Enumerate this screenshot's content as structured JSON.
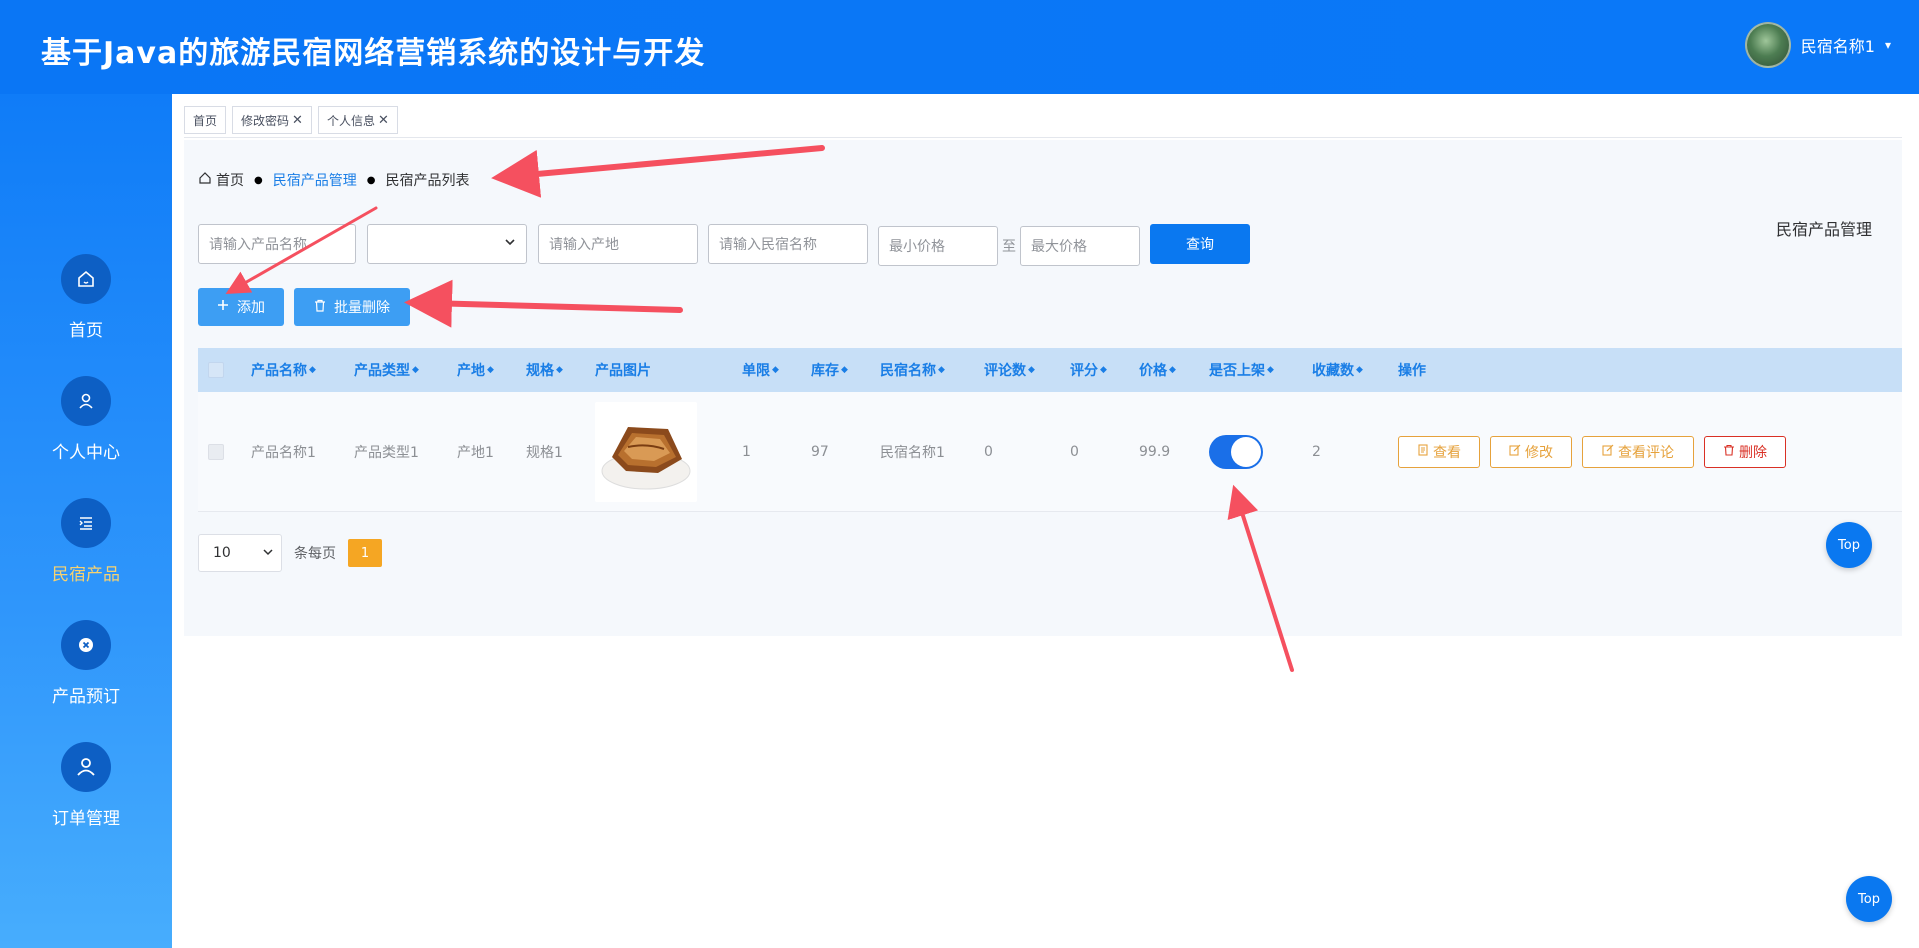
{
  "header": {
    "title": "基于Java的旅游民宿网络营销系统的设计与开发",
    "username": "民宿名称1",
    "caret": "▾"
  },
  "sidebar": {
    "items": [
      {
        "label": "首页",
        "icon": "home-icon"
      },
      {
        "label": "个人中心",
        "icon": "user-icon"
      },
      {
        "label": "民宿产品",
        "icon": "list-icon",
        "active": true
      },
      {
        "label": "产品预订",
        "icon": "close-circle-icon"
      },
      {
        "label": "订单管理",
        "icon": "person-icon"
      }
    ]
  },
  "tabs": [
    {
      "label": "首页",
      "closable": false
    },
    {
      "label": "修改密码",
      "closable": true
    },
    {
      "label": "个人信息",
      "closable": true
    }
  ],
  "breadcrumb": {
    "home": "首页",
    "section": "民宿产品管理",
    "current": "民宿产品列表"
  },
  "page_heading": "民宿产品管理",
  "search": {
    "product_name_placeholder": "请输入产品名称",
    "product_type_value": "",
    "origin_placeholder": "请输入产地",
    "homestay_name_placeholder": "请输入民宿名称",
    "min_price_placeholder": "最小价格",
    "range_separator": "至",
    "max_price_placeholder": "最大价格",
    "query_label": "查询"
  },
  "actions": {
    "add_label": "添加",
    "batch_delete_label": "批量删除"
  },
  "table": {
    "headers": [
      "产品名称",
      "产品类型",
      "产地",
      "规格",
      "产品图片",
      "单限",
      "库存",
      "民宿名称",
      "评论数",
      "评分",
      "价格",
      "是否上架",
      "收藏数",
      "操作"
    ],
    "rows": [
      {
        "name": "产品名称1",
        "type": "产品类型1",
        "origin": "产地1",
        "spec": "规格1",
        "limit": "1",
        "stock": "97",
        "homestay": "民宿名称1",
        "comments": "0",
        "rating": "0",
        "price": "99.9",
        "on_shelf": true,
        "favorites": "2",
        "ops": {
          "view": "查看",
          "edit": "修改",
          "view_comments": "查看评论",
          "delete": "删除"
        }
      }
    ]
  },
  "pagination": {
    "page_size": "10",
    "per_page_label": "条每页",
    "current_page": "1"
  },
  "top_button_label": "Top",
  "colors": {
    "primary": "#0a78f0",
    "header": "#0a76f5",
    "active_nav": "#f7d270",
    "warning": "#e6a23c",
    "danger": "#d93025",
    "annotation_arrow": "#f5505f"
  }
}
